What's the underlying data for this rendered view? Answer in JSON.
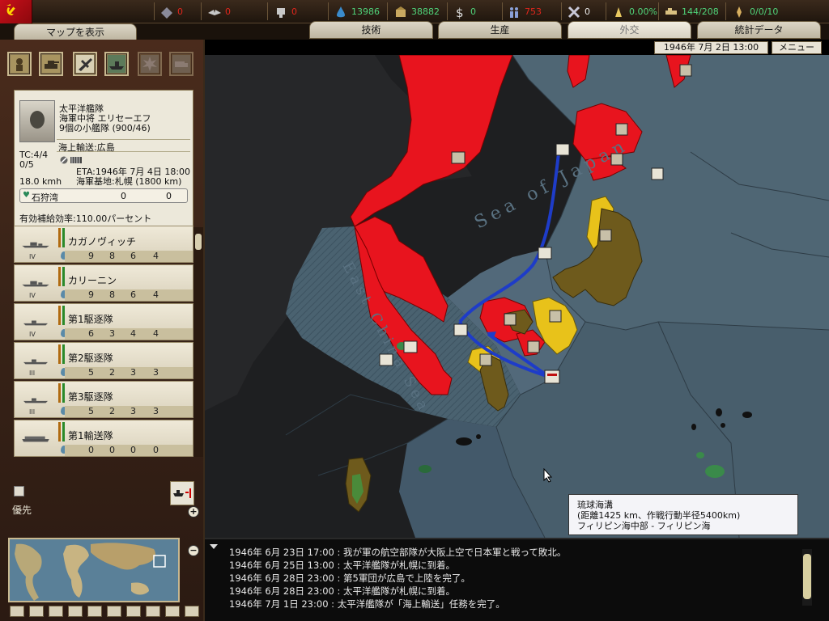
{
  "topbar": {
    "resources": [
      {
        "icon": "rare-materials-icon",
        "value": "0",
        "status": "red"
      },
      {
        "icon": "wings-icon",
        "value": "0",
        "status": "red"
      },
      {
        "icon": "transport-icon",
        "value": "0",
        "status": "red"
      },
      {
        "icon": "oil-icon",
        "value": "13986",
        "status": "ok"
      },
      {
        "icon": "supplies-icon",
        "value": "38882",
        "status": "ok"
      },
      {
        "icon": "money-icon",
        "value": "0",
        "status": "ok"
      },
      {
        "icon": "manpower-icon",
        "value": "753",
        "status": "red"
      },
      {
        "icon": "diplomacy-icon",
        "value": "0",
        "status": "white"
      },
      {
        "icon": "dissent-icon",
        "value": "0.00%",
        "status": "ok"
      },
      {
        "icon": "convoy-icon",
        "value": "144/208",
        "status": "ok"
      },
      {
        "icon": "nuke-icon",
        "value": "0/0/10",
        "status": "ok"
      }
    ],
    "flag_color": "#c8101a"
  },
  "tabs": {
    "show_map": "マップを表示",
    "tech": "技術",
    "production": "生産",
    "diplomacy": "外交",
    "stats": "統計データ"
  },
  "date": "1946年 7月 2日 13:00",
  "menu": "メニュー",
  "leader": {
    "fleet": "太平洋艦隊",
    "commander": "海軍中将 エリセーエフ",
    "fleet_size": "9個の小艦隊 (900/46)",
    "mission": "海上輸送:広島",
    "tc": "TC:4/4",
    "tc2": "0/5",
    "speed": "18.0 kmh",
    "eta": "ETA:1946年 7月 4日 18:00",
    "base": "海軍基地:札幌 (1800 km)",
    "stratres_name": "石狩湾",
    "stratres_a": "0",
    "stratres_b": "0",
    "supply": "有効補給効率:110.00パーセント"
  },
  "ships": [
    {
      "name": "カガノヴィッチ",
      "rank": "IV",
      "stats": [
        "9",
        "8",
        "6",
        "4"
      ],
      "type": "battleship"
    },
    {
      "name": "カリーニン",
      "rank": "IV",
      "stats": [
        "9",
        "8",
        "6",
        "4"
      ],
      "type": "battleship"
    },
    {
      "name": "第1駆逐隊",
      "rank": "IV",
      "stats": [
        "6",
        "3",
        "4",
        "4"
      ],
      "type": "destroyer"
    },
    {
      "name": "第2駆逐隊",
      "rank": "III",
      "stats": [
        "5",
        "2",
        "3",
        "3"
      ],
      "type": "destroyer"
    },
    {
      "name": "第3駆逐隊",
      "rank": "III",
      "stats": [
        "5",
        "2",
        "3",
        "3"
      ],
      "type": "destroyer"
    },
    {
      "name": "第1輸送隊",
      "rank": "",
      "stats": [
        "0",
        "0",
        "0",
        "0"
      ],
      "type": "transport"
    }
  ],
  "priority_label": "優先",
  "map_labels": {
    "sea_of_japan": "Sea of Japan",
    "east_china_sea": "East China Sea"
  },
  "tooltip": {
    "line1": "琉球海溝",
    "line2": "(距離1425 km、作戦行動半径5400km)",
    "line3": "フィリピン海中部 - フィリピン海"
  },
  "log": [
    "1946年 6月 23日 17:00 : 我が軍の航空部隊が大阪上空で日本軍と戦って敗北。",
    "1946年 6月 25日 13:00 : 太平洋艦隊が札幌に到着。",
    "1946年 6月 28日 23:00 : 第5軍団が広島で上陸を完了。",
    "1946年 6月 28日 23:00 : 太平洋艦隊が札幌に到着。",
    "1946年 7月 1日 23:00 : 太平洋艦隊が「海上輸送」任務を完了。"
  ],
  "colors": {
    "soviet": "#e8141e",
    "japan": "#6e5a1c",
    "puppet": "#e8c21a",
    "sea": "#4f6674",
    "route": "#1e3cc8"
  }
}
